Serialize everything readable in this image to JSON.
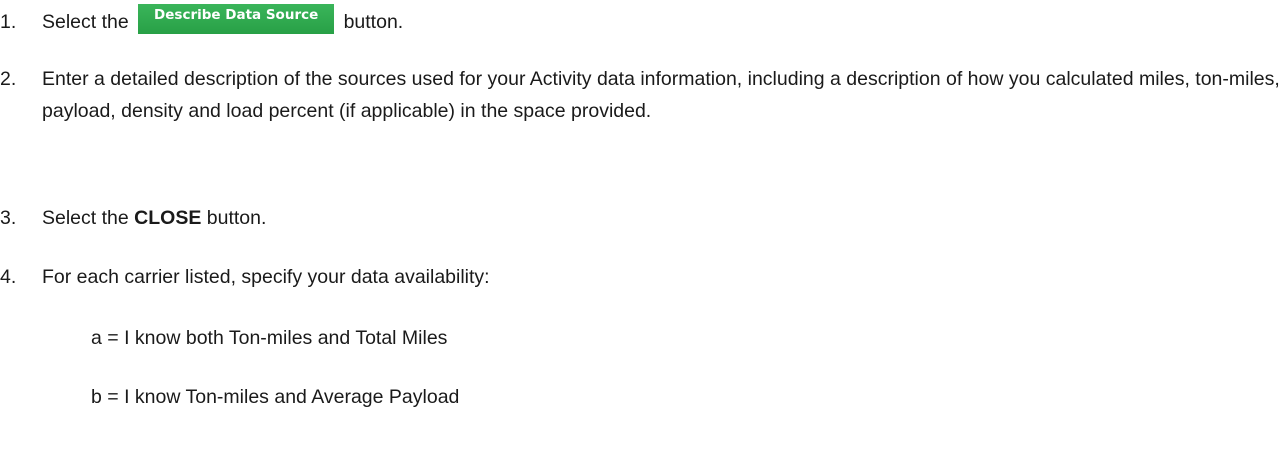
{
  "steps": [
    {
      "num": "1.",
      "before": "Select the",
      "button_label": "Describe Data Source",
      "after": "button."
    },
    {
      "num": "2.",
      "text": "Enter a detailed description of the sources used for your Activity data information, including a description of how you calculated miles, ton-miles, payload, density and load percent (if applicable) in the space provided."
    },
    {
      "num": "3.",
      "before": "Select the",
      "bold": "CLOSE",
      "after": "button."
    },
    {
      "num": "4.",
      "text": "For each carrier listed, specify your data availability:"
    }
  ],
  "options": [
    "a = I know both Ton-miles and Total Miles",
    "b = I know Ton-miles and Average Payload"
  ],
  "colors": {
    "button_bg": "#2ea44f",
    "button_text": "#ffffff"
  }
}
